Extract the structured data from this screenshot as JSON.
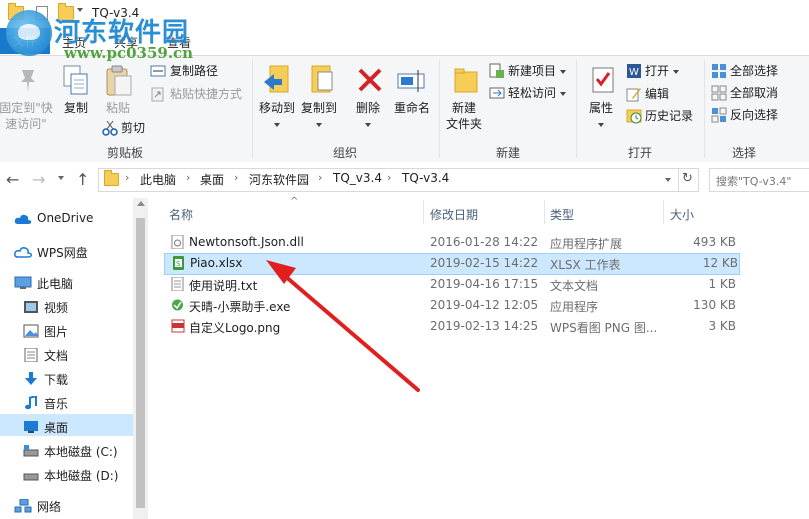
{
  "window": {
    "title": "TQ-v3.4"
  },
  "watermark": {
    "name": "河东软件园",
    "url": "www.pc0359.cn"
  },
  "tabs": {
    "file": "文件",
    "home": "主页",
    "share": "共享",
    "view": "查看"
  },
  "ribbon": {
    "clipboard": {
      "label": "剪贴板",
      "pin": "固定到\"快\n速访问\"",
      "copy": "复制",
      "paste": "粘贴",
      "cut": "剪切",
      "copy_path": "复制路径",
      "paste_shortcut": "粘贴快捷方式"
    },
    "organize": {
      "label": "组织",
      "move_to": "移动到",
      "copy_to": "复制到",
      "delete": "删除",
      "rename": "重命名"
    },
    "new": {
      "label": "新建",
      "new_folder": "新建\n文件夹",
      "new_item": "新建项目",
      "easy_access": "轻松访问"
    },
    "open": {
      "label": "打开",
      "properties": "属性",
      "open": "打开",
      "edit": "编辑",
      "history": "历史记录"
    },
    "select": {
      "label": "选择",
      "select_all": "全部选择",
      "select_none": "全部取消",
      "invert": "反向选择"
    }
  },
  "address": {
    "crumbs": [
      "此电脑",
      "桌面",
      "河东软件园",
      "TQ_v3.4",
      "TQ-v3.4"
    ],
    "search_placeholder": "搜索\"TQ-v3.4\""
  },
  "nav": {
    "onedrive": "OneDrive",
    "wps": "WPS网盘",
    "thispc": "此电脑",
    "videos": "视频",
    "pictures": "图片",
    "documents": "文档",
    "downloads": "下载",
    "music": "音乐",
    "desktop": "桌面",
    "disk_c": "本地磁盘 (C:)",
    "disk_d": "本地磁盘 (D:)",
    "network": "网络"
  },
  "columns": {
    "name": "名称",
    "date": "修改日期",
    "type": "类型",
    "size": "大小"
  },
  "files": [
    {
      "name": "Newtonsoft.Json.dll",
      "date": "2016-01-28 14:22",
      "type": "应用程序扩展",
      "size": "493 KB"
    },
    {
      "name": "Piao.xlsx",
      "date": "2019-02-15 14:22",
      "type": "XLSX 工作表",
      "size": "12 KB"
    },
    {
      "name": "使用说明.txt",
      "date": "2019-04-16 17:15",
      "type": "文本文档",
      "size": "1 KB"
    },
    {
      "name": "天晴-小票助手.exe",
      "date": "2019-04-12 12:05",
      "type": "应用程序",
      "size": "130 KB"
    },
    {
      "name": "自定义Logo.png",
      "date": "2019-02-13 14:25",
      "type": "WPS看图 PNG 图...",
      "size": "3 KB"
    }
  ],
  "colors": {
    "selection": "#cce8ff",
    "accent": "#1979ca",
    "arrow": "#e02020"
  }
}
